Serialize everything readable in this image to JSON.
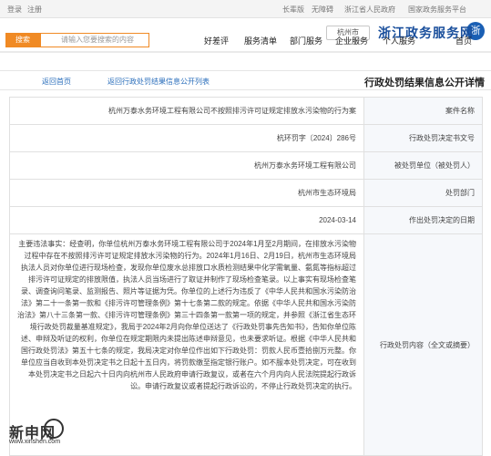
{
  "topbar": {
    "left_items": [
      "登录",
      "注册"
    ],
    "right_items": [
      "国家政务服务平台",
      "浙江省人民政府",
      "无障碍",
      "长辈版"
    ]
  },
  "header": {
    "logo_text": "浙江政务服务网",
    "region": "杭州市"
  },
  "nav": {
    "items": [
      "首页",
      "个人服务",
      "企业服务",
      "部门服务",
      "服务清单",
      "好差评"
    ]
  },
  "search": {
    "placeholder": "请输入您要搜索的内容",
    "button": "搜索"
  },
  "detail": {
    "title": "行政处罚结果信息公开详情",
    "back_link": "返回行政处罚结果信息公开列表",
    "back_link2": "返回首页"
  },
  "table": {
    "rows": [
      {
        "label": "案件名称",
        "value": "杭州万泰水务环境工程有限公司不按照排污许可证规定排放水污染物的行为案"
      },
      {
        "label": "行政处罚决定书文号",
        "value": "杭环罚字〔2024〕286号"
      },
      {
        "label": "被处罚单位（被处罚人）",
        "value": "杭州万泰水务环境工程有限公司"
      },
      {
        "label": "处罚部门",
        "value": "杭州市生态环境局"
      },
      {
        "label": "作出处罚决定的日期",
        "value": "2024-03-14"
      },
      {
        "label": "行政处罚内容（全文或摘要）",
        "value": "主要违法事实：经查明，你单位杭州万泰水务环境工程有限公司于2024年1月至2月期间，在排放水污染物过程中存在不按照排污许可证规定排放水污染物的行为。2024年1月16日、2月19日，杭州市生态环境局执法人员对你单位进行现场检查，发现你单位废水总排放口水质检测结果中化学需氧量、氨氮等指标超过排污许可证规定的排放限值，执法人员当场进行了取证并制作了现场检查笔录。以上事实有现场检查笔录、调查询问笔录、监测报告、照片等证据为凭。你单位的上述行为违反了《中华人民共和国水污染防治法》第二十一条第一款和《排污许可管理条例》第十七条第二款的规定。依据《中华人民共和国水污染防治法》第八十三条第一款、《排污许可管理条例》第三十四条第一款第一项的规定，并参照《浙江省生态环境行政处罚裁量基准规定》，我局于2024年2月向你单位送达了《行政处罚事先告知书》，告知你单位陈述、申辩及听证的权利，你单位在规定期限内未提出陈述申辩意见，也未要求听证。根据《中华人民共和国行政处罚法》第五十七条的规定，我局决定对你单位作出如下行政处罚：罚款人民币壹拾捌万元整。你单位应当自收到本处罚决定书之日起十五日内，将罚款缴至指定银行账户。如不服本处罚决定，可在收到本处罚决定书之日起六十日内向杭州市人民政府申请行政复议，或者在六个月内向人民法院提起行政诉讼。申请行政复议或者提起行政诉讼的，不停止行政处罚决定的执行。"
      }
    ]
  },
  "watermark": {
    "text": "新申网",
    "sub": "www.xinshen.com"
  }
}
